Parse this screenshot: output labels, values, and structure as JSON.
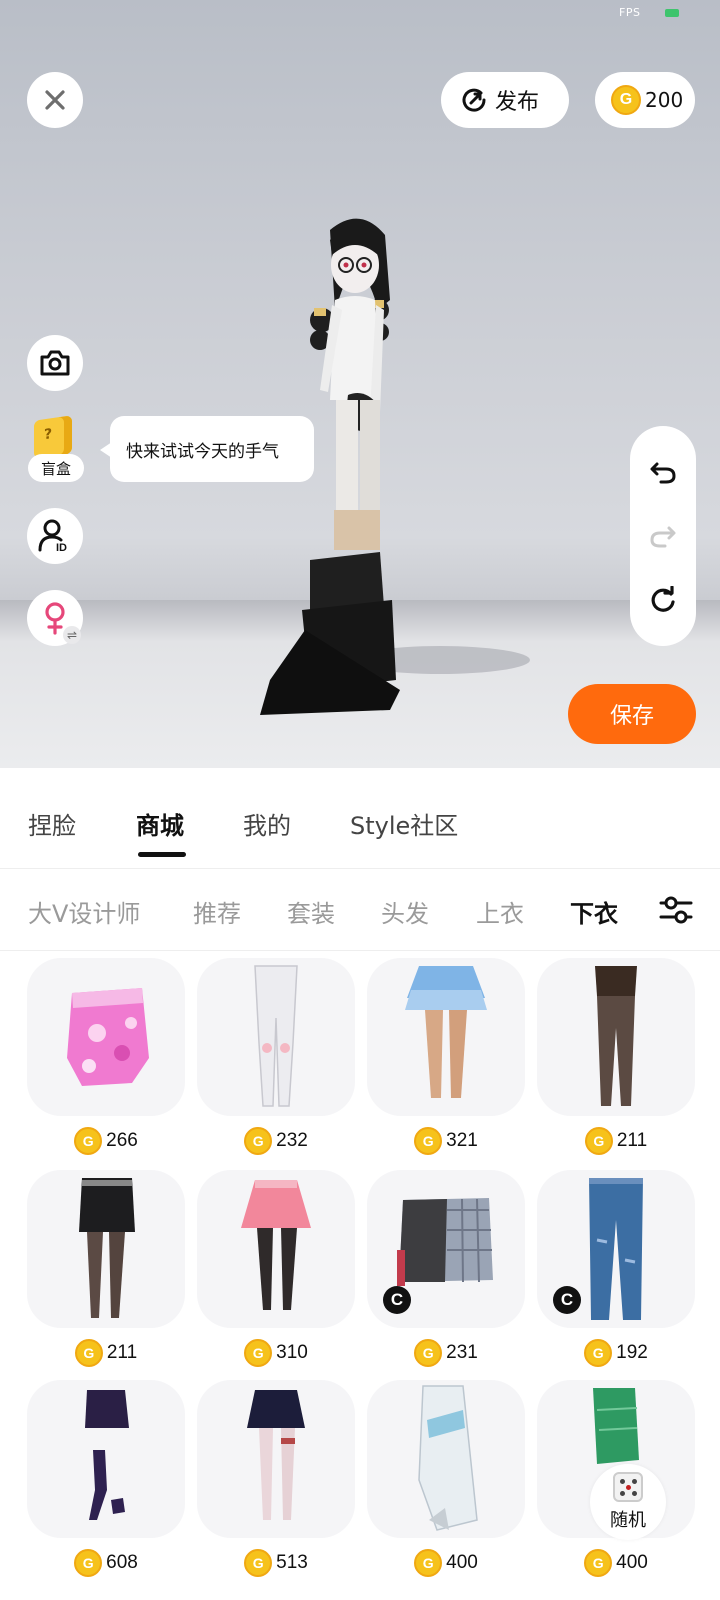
{
  "status": {
    "fps_label": "FPS"
  },
  "top_bar": {
    "publish_label": "发布",
    "coin_balance": "200"
  },
  "left_tools": {
    "blind_box_label": "盲盒",
    "tip_text": "快来试试今天的手气"
  },
  "save_label": "保存",
  "main_tabs": [
    {
      "label": "捏脸"
    },
    {
      "label": "商城"
    },
    {
      "label": "我的"
    },
    {
      "label": "Style社区"
    }
  ],
  "active_main_tab": "商城",
  "sub_tabs": [
    {
      "label": "大V设计师"
    },
    {
      "label": "推荐"
    },
    {
      "label": "套装"
    },
    {
      "label": "头发"
    },
    {
      "label": "上衣"
    },
    {
      "label": "下衣"
    }
  ],
  "active_sub_tab": "下衣",
  "items": [
    {
      "price": "266",
      "icon": "pink-camo-skirt",
      "creator_badge": false
    },
    {
      "price": "232",
      "icon": "white-leggings",
      "creator_badge": false
    },
    {
      "price": "321",
      "icon": "blue-ruffle-skirt-stockings",
      "creator_badge": false
    },
    {
      "price": "211",
      "icon": "dark-tights",
      "creator_badge": false
    },
    {
      "price": "211",
      "icon": "black-leather-skirt",
      "creator_badge": false
    },
    {
      "price": "310",
      "icon": "pink-pleated-skirt",
      "creator_badge": false
    },
    {
      "price": "231",
      "icon": "plaid-patchwork-skirt",
      "creator_badge": true
    },
    {
      "price": "192",
      "icon": "blue-jeans",
      "creator_badge": true
    },
    {
      "price": "608",
      "icon": "purple-shorts",
      "creator_badge": false
    },
    {
      "price": "513",
      "icon": "navy-pleated-skirt",
      "creator_badge": false
    },
    {
      "price": "400",
      "icon": "white-wrap-skirt",
      "creator_badge": false
    },
    {
      "price": "400",
      "icon": "green-wrap-skirt",
      "creator_badge": false
    }
  ],
  "random_label": "随机",
  "colors": {
    "accent": "#ff6a0d",
    "coin": "#f6c21b",
    "active_text": "#111111",
    "inactive_text": "#9a9a9a"
  }
}
